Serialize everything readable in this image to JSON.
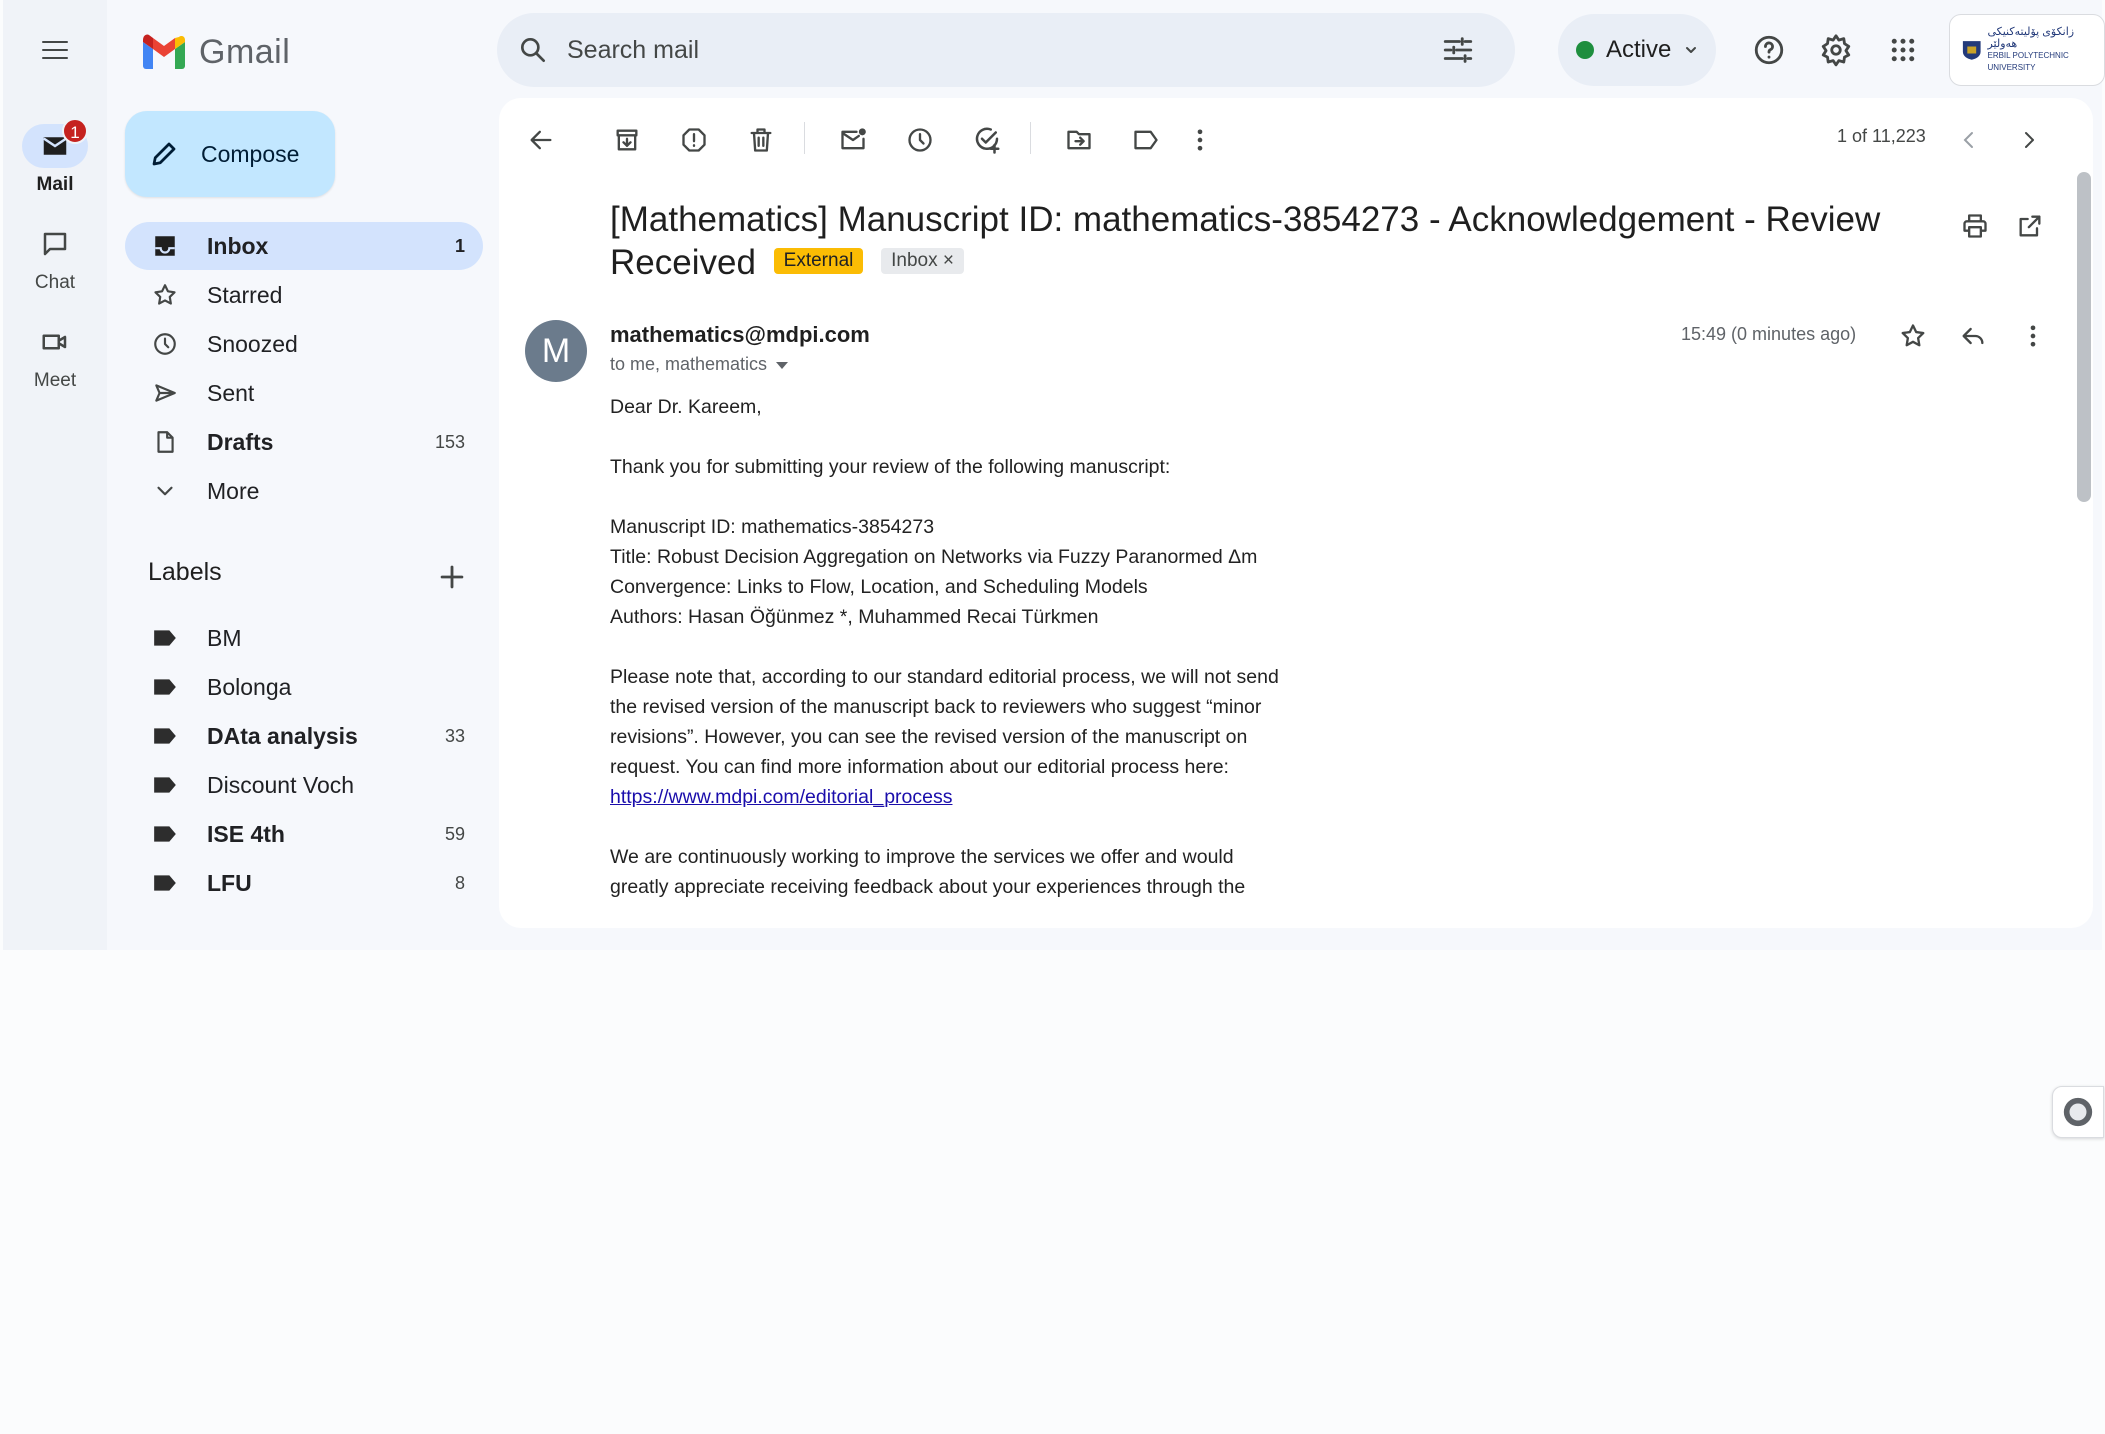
{
  "app": {
    "name": "Gmail",
    "brand_colors": {
      "red": "#ea4335",
      "blue": "#4285f4",
      "green": "#34a853",
      "yellow": "#fbbc04"
    }
  },
  "rail": {
    "items": [
      {
        "label": "Mail",
        "icon": "mail-icon",
        "badge": "1",
        "active": true
      },
      {
        "label": "Chat",
        "icon": "chat-icon"
      },
      {
        "label": "Meet",
        "icon": "video-icon"
      }
    ]
  },
  "header": {
    "search_placeholder": "Search mail",
    "status_label": "Active",
    "org_logo_text": [
      "زانکۆی پۆلیتەکنیکی هەولێر",
      "ERBIL POLYTECHNIC UNIVERSITY"
    ]
  },
  "sidebar": {
    "compose_label": "Compose",
    "nav": [
      {
        "label": "Inbox",
        "count": "1",
        "icon": "inbox-icon",
        "active": true
      },
      {
        "label": "Starred",
        "count": "",
        "icon": "star-icon"
      },
      {
        "label": "Snoozed",
        "count": "",
        "icon": "clock-icon"
      },
      {
        "label": "Sent",
        "count": "",
        "icon": "send-icon"
      },
      {
        "label": "Drafts",
        "count": "153",
        "icon": "draft-icon",
        "bold": true
      },
      {
        "label": "More",
        "count": "",
        "icon": "chevron-down-icon"
      }
    ],
    "labels_heading": "Labels",
    "labels": [
      {
        "label": "BM",
        "count": ""
      },
      {
        "label": "Bolonga",
        "count": ""
      },
      {
        "label": "DAta analysis",
        "count": "33",
        "bold": true
      },
      {
        "label": "Discount Voch",
        "count": ""
      },
      {
        "label": "ISE 4th",
        "count": "59",
        "bold": true
      },
      {
        "label": "LFU",
        "count": "8",
        "bold": true
      }
    ]
  },
  "toolbar": {
    "pager": "1 of 11,223"
  },
  "email": {
    "subject": "[Mathematics] Manuscript ID: mathematics-3854273 - Acknowledgement - Review Received",
    "chip_external": "External",
    "chip_inbox": "Inbox",
    "avatar_letter": "M",
    "sender": "mathematics@mdpi.com",
    "recipients": "to me, mathematics",
    "time": "15:49 (0 minutes ago)",
    "greeting": "Dear Dr. Kareem,",
    "intro": "Thank you for submitting your review of the following manuscript:",
    "manuscript_id": "Manuscript ID: mathematics-3854273",
    "title": "Title: Robust Decision Aggregation on Networks via Fuzzy Paranormed Δm Convergence: Links to Flow, Location, and Scheduling Models",
    "authors": "Authors: Hasan Öğünmez *, Muhammed Recai Türkmen",
    "note": "Please note that, according to our standard editorial process, we will not send the revised version of the manuscript back to reviewers who suggest “minor revisions”. However, you can see the revised version of the manuscript on request. You can find more information about our editorial process here:",
    "link": "https://www.mdpi.com/editorial_process",
    "feedback": "We are continuously working to improve the services we offer and would greatly appreciate receiving feedback about your experiences through the"
  }
}
